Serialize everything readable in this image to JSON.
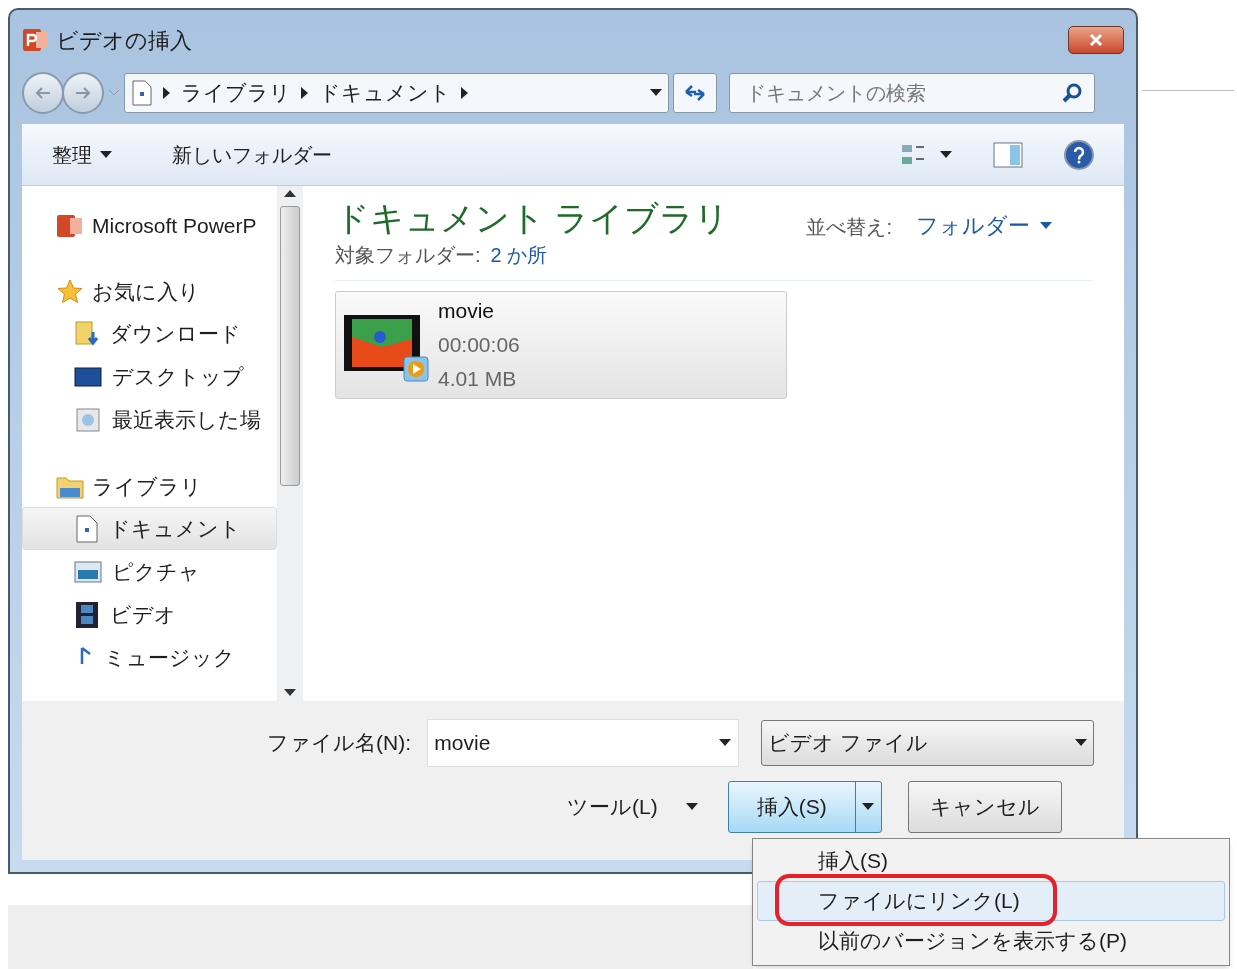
{
  "window": {
    "title": "ビデオの挿入"
  },
  "address_bar": {
    "path": [
      "ライブラリ",
      "ドキュメント"
    ]
  },
  "search": {
    "placeholder": "ドキュメントの検索"
  },
  "toolbar": {
    "organize": "整理",
    "new_folder": "新しいフォルダー"
  },
  "sidebar": {
    "items": [
      {
        "label": "Microsoft PowerP",
        "selected": false
      },
      {
        "label": "お気に入り",
        "selected": false,
        "children": [
          {
            "label": "ダウンロード",
            "selected": false
          },
          {
            "label": "デスクトップ",
            "selected": false
          },
          {
            "label": "最近表示した場",
            "selected": false
          }
        ]
      },
      {
        "label": "ライブラリ",
        "selected": false,
        "children": [
          {
            "label": "ドキュメント",
            "selected": true
          },
          {
            "label": "ピクチャ",
            "selected": false
          },
          {
            "label": "ビデオ",
            "selected": false
          },
          {
            "label": "ミュージック",
            "selected": false
          }
        ]
      }
    ]
  },
  "library": {
    "title": "ドキュメント ライブラリ",
    "subtitle_label": "対象フォルダー:",
    "subtitle_link": "2 か所",
    "sort_label": "並べ替え:",
    "sort_value": "フォルダー"
  },
  "files": [
    {
      "name": "movie",
      "duration": "00:00:06",
      "size": "4.01 MB"
    }
  ],
  "footer": {
    "file_name_label": "ファイル名(N):",
    "file_name": "movie",
    "file_type": "ビデオ ファイル",
    "tools": "ツール(L)",
    "insert": "挿入(S)",
    "cancel": "キャンセル"
  },
  "insert_menu": {
    "items": [
      {
        "label": "挿入(S)",
        "selected": false
      },
      {
        "label": "ファイルにリンク(L)",
        "selected": true
      },
      {
        "label": "以前のバージョンを表示する(P)",
        "selected": false
      }
    ]
  }
}
